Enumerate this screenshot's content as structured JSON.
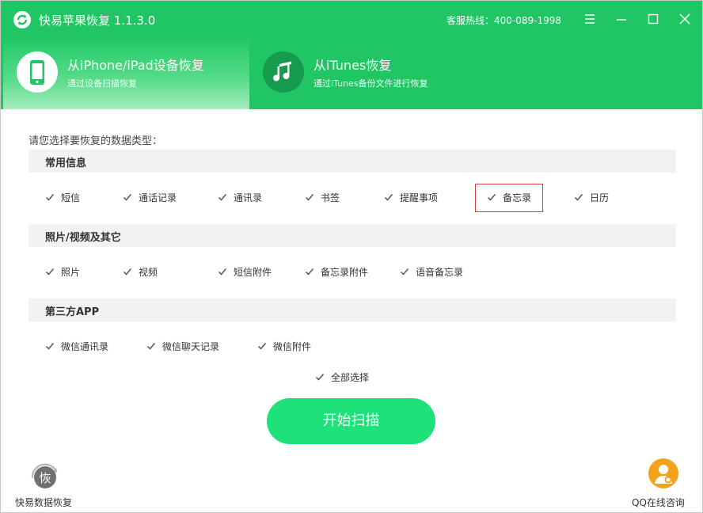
{
  "window": {
    "title": "快易苹果恢复 1.1.3.0",
    "hotline": "客服热线：400-089-1998",
    "controls": [
      "menu-icon",
      "minimize-icon",
      "maximize-icon",
      "close-icon"
    ]
  },
  "modes": [
    {
      "title": "从iPhone/iPad设备恢复",
      "subtitle": "通过设备扫描恢复",
      "icon": "phone-icon",
      "active": true
    },
    {
      "title": "从iTunes恢复",
      "subtitle": "通过iTunes备份文件进行恢复",
      "icon": "music-note-icon",
      "active": false
    }
  ],
  "prompt": "请您选择要恢复的数据类型：",
  "sections": [
    {
      "title": "常用信息",
      "items": [
        {
          "label": "短信",
          "checked": true
        },
        {
          "label": "通话记录",
          "checked": true
        },
        {
          "label": "通讯录",
          "checked": true
        },
        {
          "label": "书签",
          "checked": true
        },
        {
          "label": "提醒事项",
          "checked": true
        },
        {
          "label": "备忘录",
          "checked": true,
          "highlighted": true
        },
        {
          "label": "日历",
          "checked": true
        }
      ]
    },
    {
      "title": "照片/视频及其它",
      "items": [
        {
          "label": "照片",
          "checked": true
        },
        {
          "label": "视频",
          "checked": true
        },
        {
          "label": "短信附件",
          "checked": true
        },
        {
          "label": "备忘录附件",
          "checked": true
        },
        {
          "label": "语音备忘录",
          "checked": true
        }
      ]
    },
    {
      "title": "第三方APP",
      "items": [
        {
          "label": "微信通讯录",
          "checked": true
        },
        {
          "label": "微信聊天记录",
          "checked": true
        },
        {
          "label": "微信附件",
          "checked": true
        }
      ]
    }
  ],
  "select_all": {
    "label": "全部选择",
    "checked": true
  },
  "start_button": "开始扫描",
  "footer": {
    "left_label": "快易数据恢复",
    "left_badge": "恢",
    "right_label": "QQ在线咨询"
  },
  "colors": {
    "brand_green": "#1fc663",
    "button_green": "#1fe17a",
    "highlight_red": "#d73b3b",
    "footer_orange": "#f4a21c"
  }
}
